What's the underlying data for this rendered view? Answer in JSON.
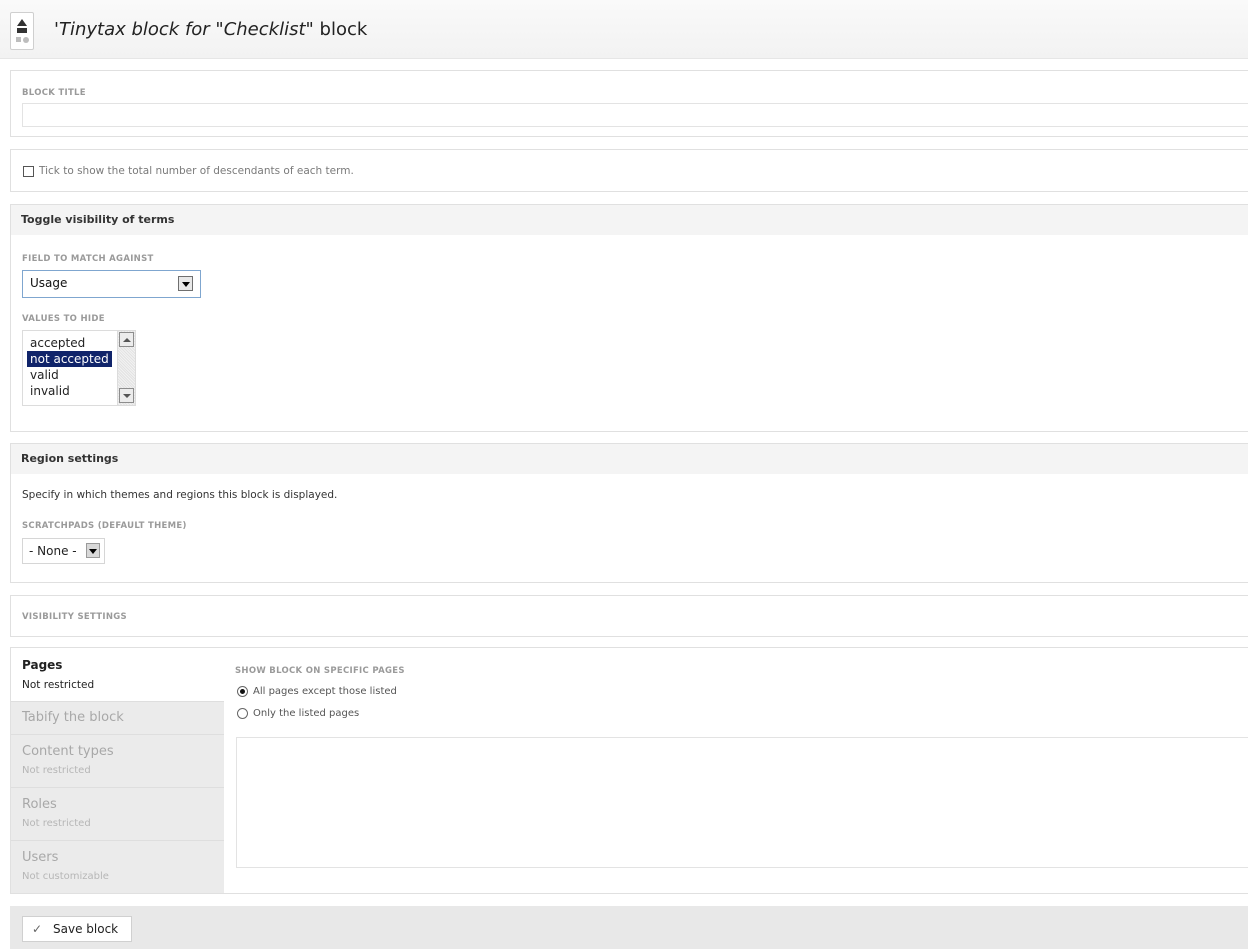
{
  "header": {
    "title_italic": "'Tinytax block for \"Checklist\"",
    "title_rest": " block"
  },
  "block_title": {
    "label": "Block title",
    "value": ""
  },
  "descendants": {
    "label": "Tick to show the total number of descendants of each term.",
    "checked": false
  },
  "toggle_visibility": {
    "heading": "Toggle visibility of terms",
    "field_label": "Field to match against",
    "field_value": "Usage",
    "values_label": "Values to hide",
    "values_options": [
      "accepted",
      "not accepted",
      "valid",
      "invalid"
    ],
    "values_selected": "not accepted"
  },
  "region_settings": {
    "heading": "Region settings",
    "description": "Specify in which themes and regions this block is displayed.",
    "theme_label": "Scratchpads (default theme)",
    "theme_value": "- None -"
  },
  "visibility_settings": {
    "heading": "Visibility settings"
  },
  "vertical_tabs": [
    {
      "title": "Pages",
      "summary": "Not restricted"
    },
    {
      "title": "Tabify the block",
      "summary": ""
    },
    {
      "title": "Content types",
      "summary": "Not restricted"
    },
    {
      "title": "Roles",
      "summary": "Not restricted"
    },
    {
      "title": "Users",
      "summary": "Not customizable"
    }
  ],
  "pages_pane": {
    "label": "Show block on specific pages",
    "option_all_except": "All pages except those listed",
    "option_only_listed": "Only the listed pages",
    "selected": "All pages except those listed",
    "pages_value": ""
  },
  "actions": {
    "save_label": "Save block",
    "save_icon": "checkmark-icon"
  }
}
